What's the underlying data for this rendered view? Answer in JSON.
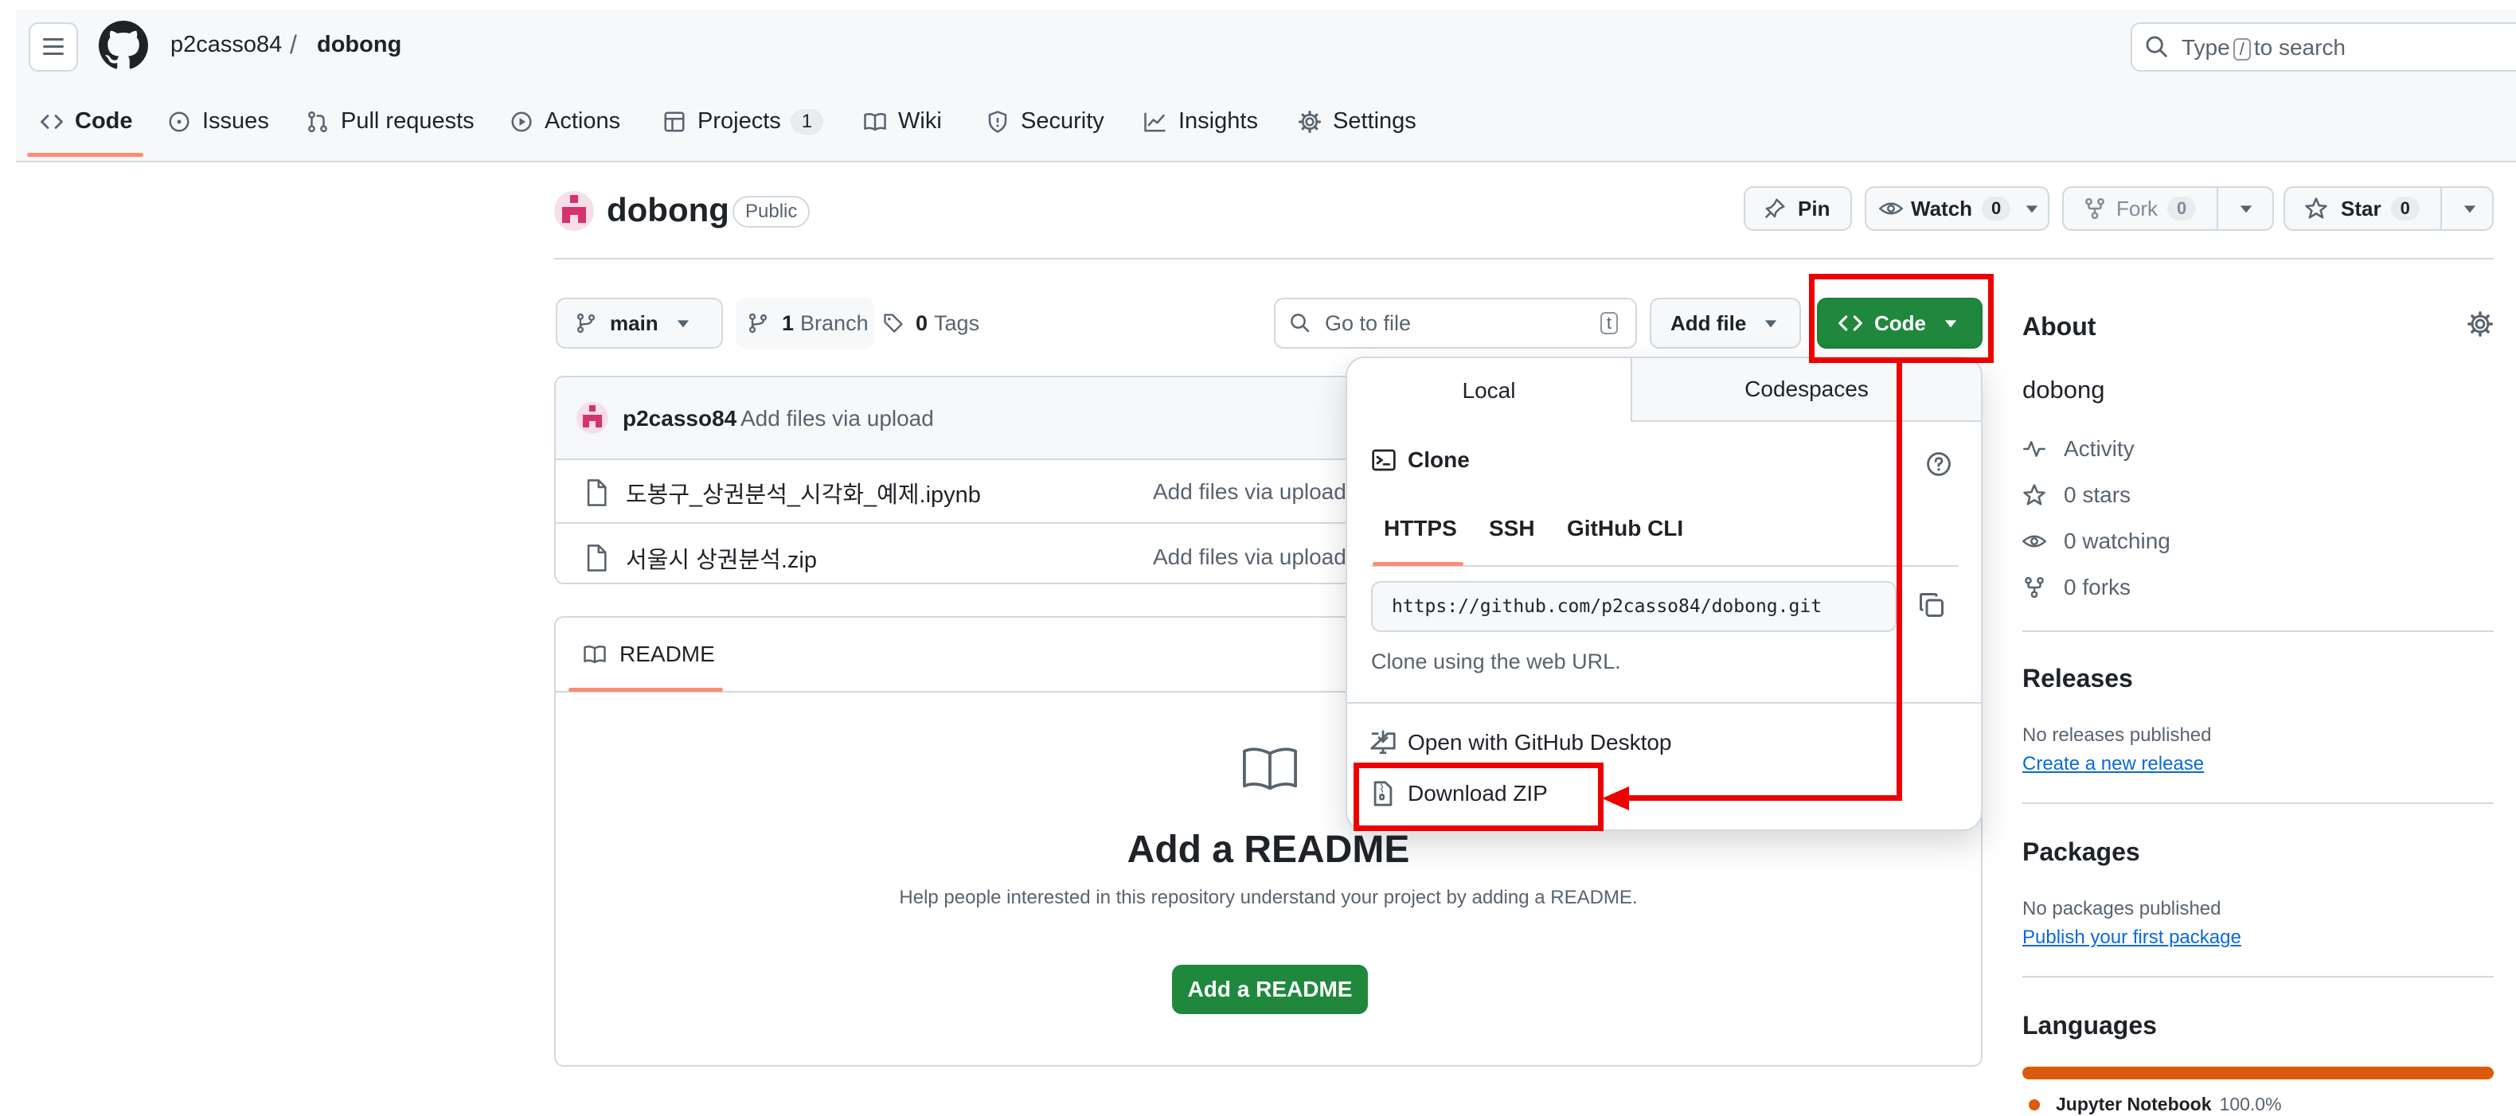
{
  "header": {
    "owner": "p2casso84",
    "separator": "/",
    "repo": "dobong",
    "search": {
      "prefix": "Type",
      "key": "/",
      "suffix": "to search"
    }
  },
  "tabs": [
    {
      "label": "Code",
      "icon": "code-icon"
    },
    {
      "label": "Issues",
      "icon": "issue-opened-icon"
    },
    {
      "label": "Pull requests",
      "icon": "pull-request-icon"
    },
    {
      "label": "Actions",
      "icon": "play-icon"
    },
    {
      "label": "Projects",
      "icon": "table-icon",
      "count": "1"
    },
    {
      "label": "Wiki",
      "icon": "book-icon"
    },
    {
      "label": "Security",
      "icon": "shield-icon"
    },
    {
      "label": "Insights",
      "icon": "graph-icon"
    },
    {
      "label": "Settings",
      "icon": "gear-icon"
    }
  ],
  "repo": {
    "name": "dobong",
    "visibility": "Public",
    "pin_label": "Pin",
    "watch_label": "Watch",
    "watch_count": "0",
    "fork_label": "Fork",
    "fork_count": "0",
    "star_label": "Star",
    "star_count": "0"
  },
  "toolbar": {
    "branch": "main",
    "branches_count": "1",
    "branches_label": "Branch",
    "tags_count": "0",
    "tags_label": "Tags",
    "goto_placeholder": "Go to file",
    "goto_key": "t",
    "add_file": "Add file",
    "code": "Code"
  },
  "commit": {
    "author": "p2casso84",
    "message": "Add files via upload"
  },
  "files": [
    {
      "name": "도봉구_상권분석_시각화_예제.ipynb",
      "message": "Add files via upload"
    },
    {
      "name": "서울시 상권분석.zip",
      "message": "Add files via upload"
    }
  ],
  "readme": {
    "tab": "README",
    "heading": "Add a README",
    "description": "Help people interested in this repository understand your project by adding a README.",
    "button": "Add a README"
  },
  "code_dropdown": {
    "tab_local": "Local",
    "tab_codespaces": "Codespaces",
    "clone_title": "Clone",
    "protocols": [
      "HTTPS",
      "SSH",
      "GitHub CLI"
    ],
    "url": "https://github.com/p2casso84/dobong.git",
    "hint": "Clone using the web URL.",
    "open_desktop": "Open with GitHub Desktop",
    "download_zip": "Download ZIP"
  },
  "about": {
    "title": "About",
    "description": "dobong",
    "activity": "Activity",
    "stars": "0 stars",
    "watching": "0 watching",
    "forks": "0 forks"
  },
  "releases": {
    "title": "Releases",
    "empty": "No releases published",
    "link": "Create a new release"
  },
  "packages": {
    "title": "Packages",
    "empty": "No packages published",
    "link": "Publish your first package"
  },
  "languages": {
    "title": "Languages",
    "items": [
      {
        "name": "Jupyter Notebook",
        "percent": "100.0%",
        "color": "#DA5B0B"
      }
    ]
  },
  "colors": {
    "primary_green": "#1f883d",
    "annotation_red": "#ee0000",
    "tab_underline": "#fd8c73",
    "link_blue": "#0969da"
  }
}
